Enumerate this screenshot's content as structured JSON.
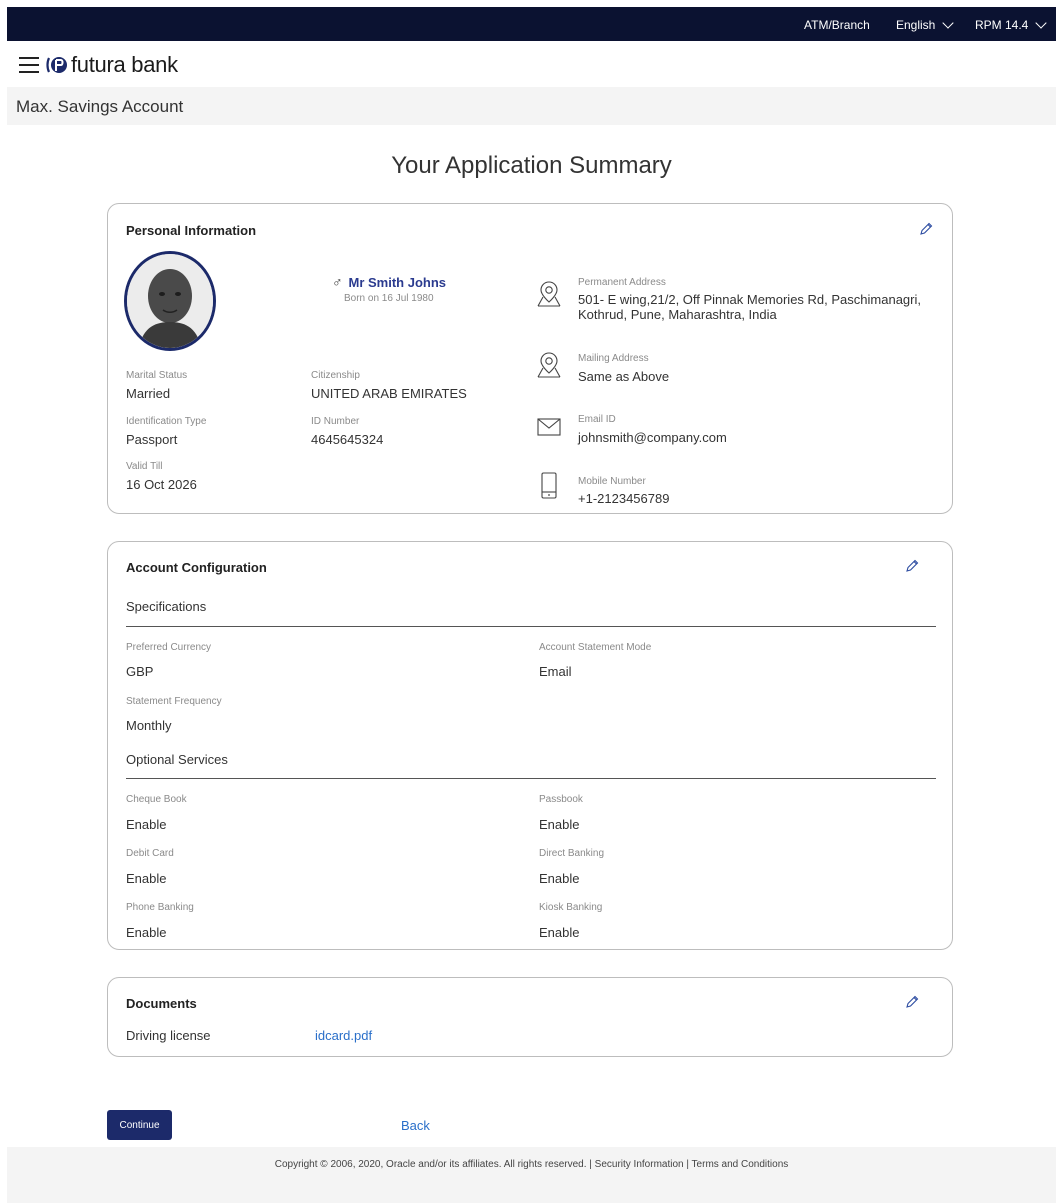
{
  "topbar": {
    "atm_branch": "ATM/Branch",
    "language": "English",
    "version": "RPM 14.4"
  },
  "brand": {
    "name": "futura bank"
  },
  "page": {
    "breadcrumb": "Max. Savings Account",
    "title": "Your Application Summary"
  },
  "personal": {
    "title": "Personal Information",
    "name": "Mr Smith Johns",
    "dob": "Born on 16 Jul 1980",
    "marital_status_label": "Marital Status",
    "marital_status": "Married",
    "citizenship_label": "Citizenship",
    "citizenship": "UNITED ARAB EMIRATES",
    "id_type_label": "Identification Type",
    "id_type": "Passport",
    "id_number_label": "ID Number",
    "id_number": "4645645324",
    "valid_till_label": "Valid Till",
    "valid_till": "16 Oct 2026",
    "permanent_address_label": "Permanent Address",
    "permanent_address_line1": "501- E wing,21/2, Off Pinnak Memories Rd, Paschimanagri,",
    "permanent_address_line2": "Kothrud, Pune, Maharashtra, India",
    "mailing_address_label": "Mailing Address",
    "mailing_address": "Same as Above",
    "email_label": "Email ID",
    "email": "johnsmith@company.com",
    "mobile_label": "Mobile Number",
    "mobile": "+1-2123456789"
  },
  "account": {
    "title": "Account Configuration",
    "specifications_label": "Specifications",
    "preferred_currency_label": "Preferred Currency",
    "preferred_currency": "GBP",
    "statement_mode_label": "Account Statement Mode",
    "statement_mode": "Email",
    "statement_frequency_label": "Statement Frequency",
    "statement_frequency": "Monthly",
    "optional_services_label": "Optional Services",
    "cheque_book_label": "Cheque Book",
    "cheque_book": "Enable",
    "passbook_label": "Passbook",
    "passbook": "Enable",
    "debit_card_label": "Debit Card",
    "debit_card": "Enable",
    "direct_banking_label": "Direct Banking",
    "direct_banking": "Enable",
    "phone_banking_label": "Phone Banking",
    "phone_banking": "Enable",
    "kiosk_banking_label": "Kiosk Banking",
    "kiosk_banking": "Enable"
  },
  "documents": {
    "title": "Documents",
    "doc_type": "Driving license",
    "doc_file": "idcard.pdf"
  },
  "actions": {
    "continue": "Continue",
    "back": "Back"
  },
  "footer": {
    "text": "Copyright © 2006, 2020, Oracle and/or its affiliates. All rights reserved. | Security Information | Terms and Conditions"
  },
  "colors": {
    "topbar_bg": "#0b1231",
    "brand_dark": "#1c2a6a",
    "link": "#2a6fc9"
  }
}
